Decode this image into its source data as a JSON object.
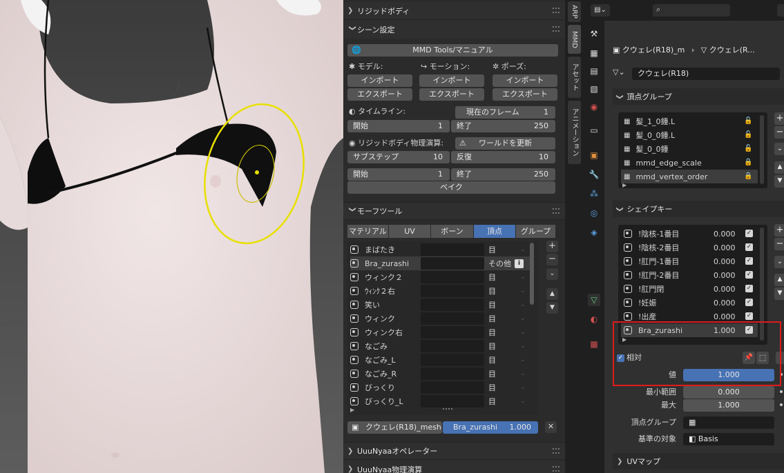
{
  "npanel": {
    "rigid_header": "リジッドボディ",
    "scene_header": "シーン設定",
    "manual_btn": "MMD Tools/マニュアル",
    "model_label": "モデル:",
    "motion_label": "モーション:",
    "pose_label": "ポーズ:",
    "import": "インポート",
    "export": "エクスポート",
    "timeline_label": "タイムライン:",
    "current_frame_label": "現在のフレーム",
    "current_frame_value": "1",
    "start_label": "開始",
    "start_value": "1",
    "end_label": "終了",
    "end_value": "250",
    "rigid_sim_label": "リジッドボディ物理演算:",
    "update_world": "ワールドを更新",
    "substep_label": "サブステップ",
    "substep_value": "10",
    "iter_label": "反復",
    "iter_value": "10",
    "start2_value": "1",
    "end2_value": "250",
    "bake": "ベイク",
    "morph_header": "モーフツール",
    "morph_tabs": [
      "マテリアル",
      "UV",
      "ボーン",
      "頂点",
      "グループ"
    ],
    "morph_items": [
      {
        "name": "まばたき",
        "cat": "目"
      },
      {
        "name": "Bra_zurashi",
        "cat": "その他"
      },
      {
        "name": "ウィンク２",
        "cat": "目"
      },
      {
        "name": "ｳｨﾝｸ２右",
        "cat": "目"
      },
      {
        "name": "笑い",
        "cat": "目"
      },
      {
        "name": "ウィンク",
        "cat": "目"
      },
      {
        "name": "ウィンク右",
        "cat": "目"
      },
      {
        "name": "なごみ",
        "cat": "目"
      },
      {
        "name": "なごみ_L",
        "cat": "目"
      },
      {
        "name": "なごみ_R",
        "cat": "目"
      },
      {
        "name": "びっくり",
        "cat": "目"
      },
      {
        "name": "びっくり_L",
        "cat": "目"
      }
    ],
    "mesh_name": "クウェレ(R18)_mesh",
    "morph_active": "Bra_zurashi",
    "morph_active_value": "1.000",
    "uuu_operator": "UuuNyaaオペレーター",
    "uuu_physics": "UuuNyaa物理演算"
  },
  "vtabs": [
    "ARP",
    "MMD",
    "アセット",
    "アニメーション"
  ],
  "props": {
    "breadcrumb_obj": "クウェレ(R18)_m",
    "breadcrumb_mesh": "クウェレ(R...",
    "mesh_datablock": "クウェレ(R18)",
    "vg_header": "頂点グループ",
    "vertex_groups": [
      "髪_1_0鍾.L",
      "髪_0_0鍾.L",
      "髪_0_0鍾",
      "mmd_edge_scale",
      "mmd_vertex_order"
    ],
    "sk_header": "シェイプキー",
    "shape_keys": [
      {
        "name": "!陰核-1番目",
        "value": "0.000"
      },
      {
        "name": "!陰核-2番目",
        "value": "0.000"
      },
      {
        "name": "!肛門-1番目",
        "value": "0.000"
      },
      {
        "name": "!肛門-2番目",
        "value": "0.000"
      },
      {
        "name": "!肛門閉",
        "value": "0.000"
      },
      {
        "name": "!妊娠",
        "value": "0.000"
      },
      {
        "name": "!出産",
        "value": "0.000"
      },
      {
        "name": "Bra_zurashi",
        "value": "1.000"
      }
    ],
    "relative_label": "相対",
    "value_label": "値",
    "value": "1.000",
    "min_label": "最小範囲",
    "min_value": "0.000",
    "max_label": "最大",
    "max_value": "1.000",
    "vgroup_label": "頂点グループ",
    "relative_to_label": "基準の対象",
    "relative_to_value": "Basis",
    "uv_header": "UVマップ"
  },
  "colors": {
    "accent": "#4772b3",
    "highlight_box": "#e01b1b",
    "gizmo": "#e8e000"
  }
}
